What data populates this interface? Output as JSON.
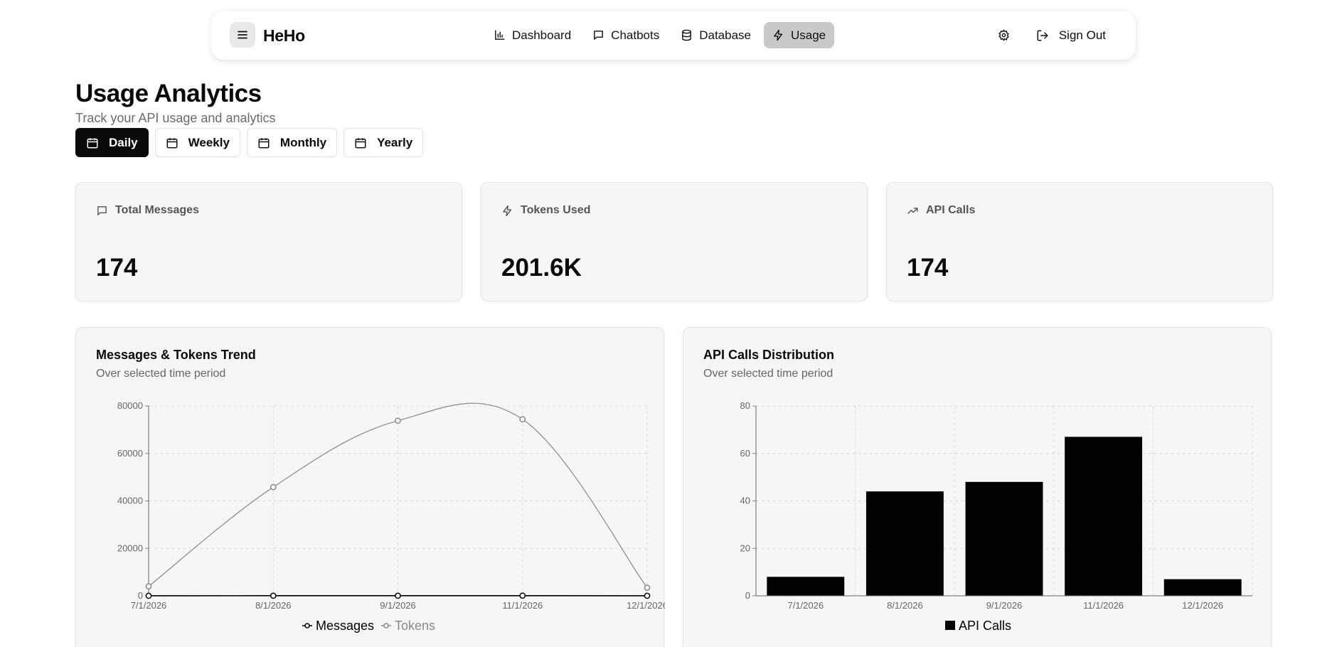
{
  "nav": {
    "brand": "HeHo",
    "links": [
      {
        "label": "Dashboard",
        "icon": "bar-chart-icon",
        "active": false
      },
      {
        "label": "Chatbots",
        "icon": "message-square-icon",
        "active": false
      },
      {
        "label": "Database",
        "icon": "database-icon",
        "active": false
      },
      {
        "label": "Usage",
        "icon": "zap-icon",
        "active": true
      }
    ],
    "signout_label": "Sign Out"
  },
  "header": {
    "title": "Usage Analytics",
    "subtitle": "Track your API usage and analytics"
  },
  "periods": [
    {
      "label": "Daily",
      "active": true
    },
    {
      "label": "Weekly",
      "active": false
    },
    {
      "label": "Monthly",
      "active": false
    },
    {
      "label": "Yearly",
      "active": false
    }
  ],
  "stats": [
    {
      "label": "Total Messages",
      "value": "174",
      "icon": "message-square-icon"
    },
    {
      "label": "Tokens Used",
      "value": "201.6K",
      "icon": "zap-icon"
    },
    {
      "label": "API Calls",
      "value": "174",
      "icon": "trending-up-icon"
    }
  ],
  "charts": {
    "trend": {
      "title": "Messages & Tokens Trend",
      "subtitle": "Over selected time period"
    },
    "distribution": {
      "title": "API Calls Distribution",
      "subtitle": "Over selected time period"
    }
  },
  "colors": {
    "messages": "#000000",
    "tokens": "#888888",
    "bars": "#000000"
  },
  "chart_data": [
    {
      "type": "line",
      "title": "Messages & Tokens Trend",
      "x": [
        "7/1/2026",
        "8/1/2026",
        "9/1/2026",
        "11/1/2026",
        "12/1/2026"
      ],
      "ylim": [
        0,
        80000
      ],
      "yticks": [
        0,
        20000,
        40000,
        60000,
        80000
      ],
      "grid": true,
      "legend": "bottom-center",
      "series": [
        {
          "name": "Messages",
          "values": [
            8,
            44,
            48,
            67,
            7
          ]
        },
        {
          "name": "Tokens",
          "values": [
            4000,
            45800,
            73800,
            74400,
            3400
          ]
        }
      ]
    },
    {
      "type": "bar",
      "title": "API Calls Distribution",
      "categories": [
        "7/1/2026",
        "8/1/2026",
        "9/1/2026",
        "11/1/2026",
        "12/1/2026"
      ],
      "ylim": [
        0,
        80
      ],
      "yticks": [
        0,
        20,
        40,
        60,
        80
      ],
      "grid": true,
      "legend": "bottom-center",
      "series": [
        {
          "name": "API Calls",
          "values": [
            8,
            44,
            48,
            67,
            7
          ]
        }
      ]
    }
  ]
}
